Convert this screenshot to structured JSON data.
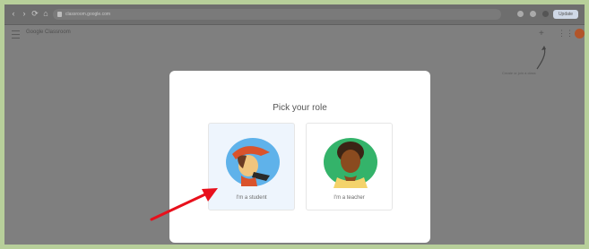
{
  "browser": {
    "url": "classroom.google.com",
    "profile_chip": "Update"
  },
  "app": {
    "title": "Google Classroom",
    "hint": "Create or join a class"
  },
  "dialog": {
    "title": "Pick your role",
    "roles": [
      {
        "label": "I'm a student",
        "color": "#5fb2ea"
      },
      {
        "label": "I'm a teacher",
        "color": "#34b36a"
      }
    ]
  },
  "colors": {
    "overlay": "#7f7f7f",
    "page_border": "#b7cf9a",
    "arrow": "#e8101c",
    "student_highlight": "#eef5fd"
  },
  "icons": [
    "back-icon",
    "forward-icon",
    "reload-icon",
    "lock-icon",
    "menu-icon",
    "plus-icon",
    "apps-grid-icon",
    "avatar",
    "arrow-annotation"
  ]
}
